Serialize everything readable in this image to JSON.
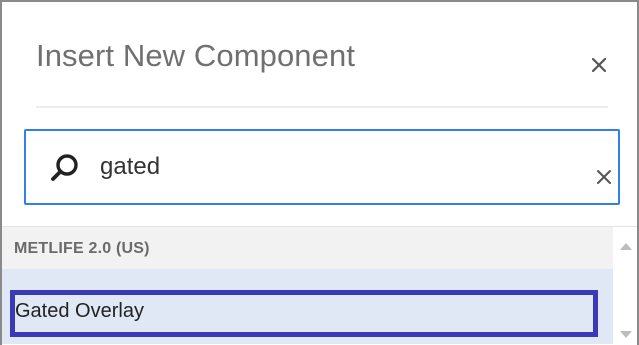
{
  "dialog": {
    "title": "Insert New Component",
    "close_icon": "close-icon"
  },
  "search": {
    "value": "gated",
    "icon": "search-icon",
    "clear_icon": "clear-icon",
    "accent_color": "#2f80ed"
  },
  "results": {
    "groups": [
      {
        "label": "METLIFE 2.0 (US)",
        "items": [
          {
            "label": "Gated Overlay",
            "selected": true
          }
        ]
      }
    ],
    "selected_bg": "#dfe8f4",
    "highlight_color": "#3a3ab8"
  },
  "scrollbar": {
    "up_icon": "scroll-up-arrow-icon",
    "down_icon": "scroll-down-arrow-icon"
  }
}
